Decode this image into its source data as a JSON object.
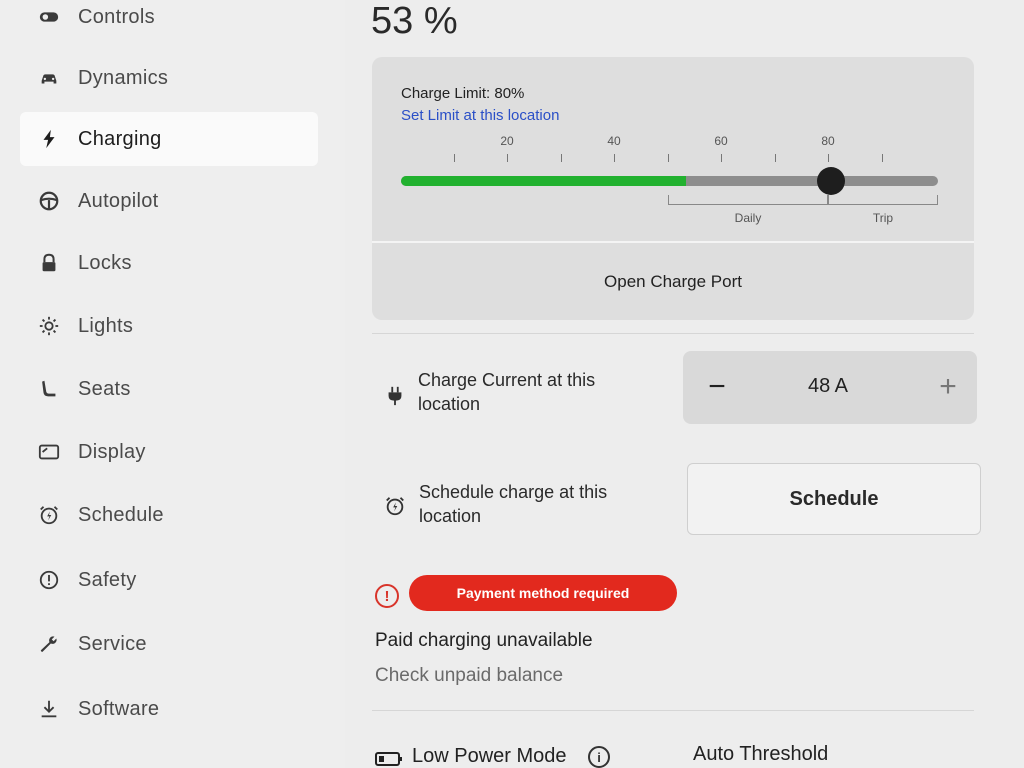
{
  "sidebar": {
    "items": [
      {
        "label": "Controls",
        "icon": "toggle-icon"
      },
      {
        "label": "Dynamics",
        "icon": "car-icon"
      },
      {
        "label": "Charging",
        "icon": "lightning-bolt-icon",
        "active": true
      },
      {
        "label": "Autopilot",
        "icon": "steering-wheel-icon"
      },
      {
        "label": "Locks",
        "icon": "lock-icon"
      },
      {
        "label": "Lights",
        "icon": "light-icon"
      },
      {
        "label": "Seats",
        "icon": "seat-icon"
      },
      {
        "label": "Display",
        "icon": "display-icon"
      },
      {
        "label": "Schedule",
        "icon": "alarm-clock-icon"
      },
      {
        "label": "Safety",
        "icon": "exclamation-circle-icon"
      },
      {
        "label": "Service",
        "icon": "wrench-icon"
      },
      {
        "label": "Software",
        "icon": "download-icon"
      }
    ]
  },
  "main": {
    "battery_percent": "53 %",
    "charge_card": {
      "charge_limit_text": "Charge Limit: 80%",
      "set_limit_link": "Set Limit at this location",
      "tick_labels": [
        "20",
        "40",
        "60",
        "80"
      ],
      "current_charge_fraction": 0.53,
      "limit_fraction": 0.8,
      "daily_label": "Daily",
      "trip_label": "Trip",
      "open_port_label": "Open Charge Port",
      "colors": {
        "fill": "#22b12f",
        "track": "#8d8d8d",
        "knob": "#1e1e1e"
      }
    },
    "charge_current": {
      "label": "Charge Current at this location",
      "minus": "−",
      "value": "48 A",
      "plus": "+"
    },
    "schedule": {
      "label": "Schedule charge at this location",
      "button": "Schedule"
    },
    "payment": {
      "alert_icon": "!",
      "badge": "Payment method required",
      "title": "Paid charging unavailable",
      "link": "Check unpaid balance",
      "badge_color": "#e2291e"
    },
    "low_power": {
      "label": "Low Power Mode",
      "info_icon": "i",
      "value": "Auto Threshold"
    }
  }
}
